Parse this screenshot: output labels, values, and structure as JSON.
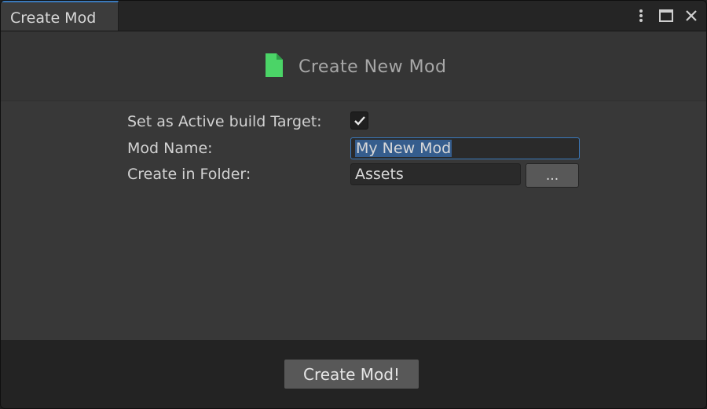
{
  "window": {
    "tab_title": "Create Mod"
  },
  "header": {
    "title": "Create New Mod",
    "icon": "file-icon",
    "icon_color": "#4bd467"
  },
  "form": {
    "active_target_label": "Set as Active build Target:",
    "active_target_checked": true,
    "mod_name_label": "Mod Name:",
    "mod_name_value": "My New Mod",
    "folder_label": "Create in Folder:",
    "folder_value": "Assets",
    "browse_label": "..."
  },
  "footer": {
    "create_label": "Create Mod!"
  },
  "colors": {
    "accent": "#3a79bb",
    "selection": "#355d8d"
  }
}
